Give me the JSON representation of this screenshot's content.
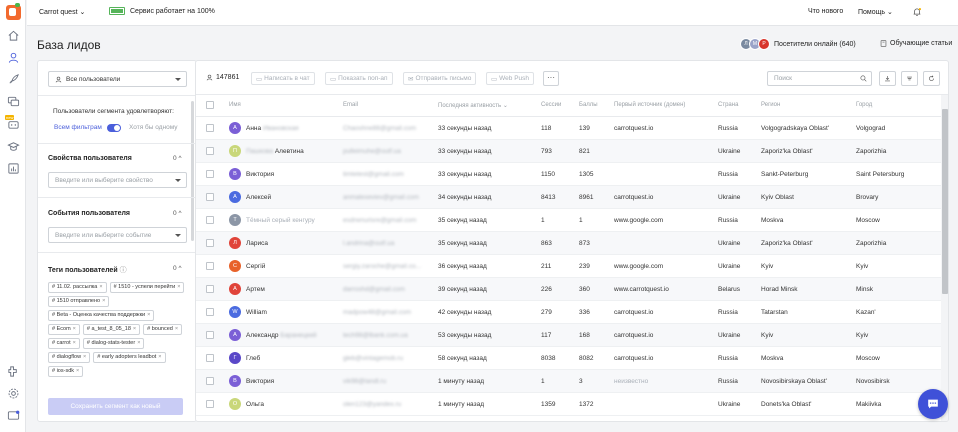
{
  "topbar": {
    "project": "Carrot quest",
    "service_status": "Сервис работает на 100%",
    "whats_new": "Что нового",
    "help": "Помощь"
  },
  "header": {
    "title": "База лидов",
    "online_label": "Посетители онлайн (640)",
    "online_avatars": [
      {
        "letter": "Л",
        "color": "#7a8aa0"
      },
      {
        "letter": "М",
        "color": "#9aa3c9"
      },
      {
        "letter": "Р",
        "color": "#d8342b"
      }
    ],
    "training_label": "Обучающие статьи"
  },
  "sidebar": {
    "segment_select": "Все пользователи",
    "conditions_label": "Пользователи сегмента удовлетворяют:",
    "all_filters": "Всем фильтрам",
    "any_filter": "Хотя бы одному",
    "properties_title": "Свойства пользователя",
    "properties_count": "0",
    "properties_placeholder": "Введите или выберите свойство",
    "events_title": "События пользователя",
    "events_count": "0",
    "events_placeholder": "Введите или выберите событие",
    "tags_title": "Теги пользователей",
    "tags_count": "0",
    "tags": [
      "# 11.02. рассылка",
      "# 1510 - успели перейти",
      "# 1510 отправлено",
      "# Beta - Оценка качества поддержки",
      "# Ecom",
      "# a_test_8_05_18",
      "# bounced",
      "# carrot",
      "# dialog-stats-tester",
      "# dialogflow",
      "# early adopters leadbot",
      "# ios-sdk"
    ],
    "save_button": "Сохранить сегмент как новый"
  },
  "toolbar": {
    "count": "147861",
    "write_chat": "Написать в чат",
    "show_popup": "Показать поп-ап",
    "send_email": "Отправить письмо",
    "web_push": "Web Push",
    "more": "···",
    "search_placeholder": "Поиск"
  },
  "table": {
    "columns": {
      "name": "Имя",
      "email": "Email",
      "last_activity": "Последняя активность",
      "sessions": "Сессии",
      "points": "Баллы",
      "first_source": "Первый источник (домен)",
      "country": "Страна",
      "region": "Регион",
      "city": "Город"
    },
    "rows": [
      {
        "letter": "А",
        "color": "#7b5fd6",
        "first": "Анна",
        "rest": "Ивановская",
        "email": "Chaoshne88@gmail.com",
        "activity": "33 секунды назад",
        "sessions": "118",
        "points": "139",
        "source": "carrotquest.io",
        "country": "Russia",
        "region": "Volgogradskaya Oblast'",
        "city": "Volgograd"
      },
      {
        "letter": "П",
        "color": "#c9d77a",
        "first": "Пашкова",
        "rest": "Алевтина",
        "email": "pulleimuhe@outf.ua",
        "activity": "33 секунды назад",
        "sessions": "793",
        "points": "821",
        "source": "",
        "country": "Ukraine",
        "region": "Zaporiz'ka Oblast'",
        "city": "Zaporizhia"
      },
      {
        "letter": "В",
        "color": "#7b5fd6",
        "first": "Виктория",
        "rest": "",
        "email": "timtetest@gmail.com",
        "activity": "33 секунды назад",
        "sessions": "1150",
        "points": "1305",
        "source": "",
        "country": "Russia",
        "region": "Sankt-Peterburg",
        "city": "Saint Petersburg"
      },
      {
        "letter": "А",
        "color": "#4b6be0",
        "first": "Алексей",
        "rest": "",
        "email": "anmalexeviev@gmail.com",
        "activity": "34 секунды назад",
        "sessions": "8413",
        "points": "8961",
        "source": "carrotquest.io",
        "country": "Ukraine",
        "region": "Kyiv Oblast",
        "city": "Brovary"
      },
      {
        "letter": "Т",
        "color": "#8c96a6",
        "first": "Тёмный серый кенгуру",
        "rest": "",
        "email": "esdrwnurisre@gmail.com",
        "activity": "35 секунд назад",
        "sessions": "1",
        "points": "1",
        "source": "www.google.com",
        "country": "Russia",
        "region": "Moskva",
        "city": "Moscow"
      },
      {
        "letter": "Л",
        "color": "#e0443a",
        "first": "Лариса",
        "rest": "",
        "email": "l.andrina@outf.ua",
        "activity": "35 секунд назад",
        "sessions": "863",
        "points": "873",
        "source": "",
        "country": "Ukraine",
        "region": "Zaporiz'ka Oblast'",
        "city": "Zaporizhia"
      },
      {
        "letter": "С",
        "color": "#e8622a",
        "first": "Сергій",
        "rest": "",
        "email": "sergiy.zaroche@gmail.co...",
        "activity": "36 секунд назад",
        "sessions": "211",
        "points": "239",
        "source": "www.google.com",
        "country": "Ukraine",
        "region": "Kyiv",
        "city": "Kyiv"
      },
      {
        "letter": "А",
        "color": "#e0443a",
        "first": "Артем",
        "rest": "",
        "email": "darroshd@gmail.com",
        "activity": "39 секунд назад",
        "sessions": "226",
        "points": "360",
        "source": "www.carrotquest.io",
        "country": "Belarus",
        "region": "Horad Minsk",
        "city": "Minsk"
      },
      {
        "letter": "W",
        "color": "#4b6be0",
        "first": "William",
        "rest": "",
        "email": "madpow48@gmail.com",
        "activity": "42 секунды назад",
        "sessions": "279",
        "points": "336",
        "source": "carrotquest.io",
        "country": "Russia",
        "region": "Tatarstan",
        "city": "Kazan'"
      },
      {
        "letter": "А",
        "color": "#7b5fd6",
        "first": "Александр",
        "rest": "Баранецкий",
        "email": "tech98@lbank.com.ua",
        "activity": "53 секунды назад",
        "sessions": "117",
        "points": "168",
        "source": "carrotquest.io",
        "country": "Ukraine",
        "region": "Kyiv",
        "city": "Kyiv"
      },
      {
        "letter": "Г",
        "color": "#5a48c8",
        "first": "Глеб",
        "rest": "",
        "email": "gleb@vintagemob.ru",
        "activity": "58 секунд назад",
        "sessions": "8038",
        "points": "8082",
        "source": "carrotquest.io",
        "country": "Russia",
        "region": "Moskva",
        "city": "Moscow"
      },
      {
        "letter": "В",
        "color": "#7b5fd6",
        "first": "Виктория",
        "rest": "",
        "email": "vik98@landl.ru",
        "activity": "1 минуту назад",
        "sessions": "1",
        "points": "3",
        "source": "неизвестно",
        "country": "Russia",
        "region": "Novosibirskaya Oblast'",
        "city": "Novosibirsk"
      },
      {
        "letter": "О",
        "color": "#c9d77a",
        "first": "Ольга",
        "rest": "",
        "email": "olen123@yandex.ru",
        "activity": "1 минуту назад",
        "sessions": "1359",
        "points": "1372",
        "source": "",
        "country": "Ukraine",
        "region": "Donets'ka Oblast'",
        "city": "Makiivka"
      }
    ]
  }
}
